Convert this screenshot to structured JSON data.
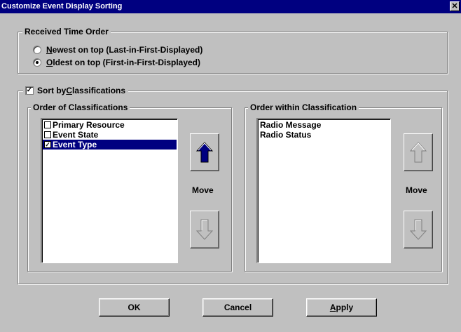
{
  "window": {
    "title": "Customize Event Display Sorting",
    "close_glyph": "✕"
  },
  "received_time_order": {
    "legend": "Received Time Order",
    "options": [
      {
        "accel": "N",
        "rest": "ewest on top (Last-in-First-Displayed)",
        "checked": false
      },
      {
        "accel": "O",
        "rest": "ldest on top (First-in-First-Displayed)",
        "checked": true
      }
    ]
  },
  "sort_by_classifications": {
    "label_prefix": "Sort by ",
    "label_accel": "C",
    "label_rest": "lassifications",
    "checked": true,
    "check_glyph": "✓"
  },
  "order_of_classifications": {
    "legend": "Order of Classifications",
    "items": [
      {
        "label": "Primary Resource",
        "checked": false,
        "selected": false
      },
      {
        "label": "Event State",
        "checked": false,
        "selected": false
      },
      {
        "label": "Event Type",
        "checked": true,
        "selected": true
      }
    ],
    "move_label": "Move",
    "up_icon": "arrow-up-icon",
    "down_icon": "arrow-down-icon",
    "up_enabled": true,
    "down_enabled": false
  },
  "order_within_classification": {
    "legend": "Order within Classification",
    "items": [
      "Radio Message",
      "Radio Status"
    ],
    "move_label": "Move",
    "up_enabled": false,
    "down_enabled": false
  },
  "buttons": {
    "ok": "OK",
    "cancel": "Cancel",
    "apply_accel": "A",
    "apply_rest": "pply"
  },
  "colors": {
    "titlebar": "#000080",
    "face": "#c0c0c0",
    "selection": "#000080",
    "arrow_enabled": "#000080",
    "arrow_disabled": "#c0c0c0"
  }
}
